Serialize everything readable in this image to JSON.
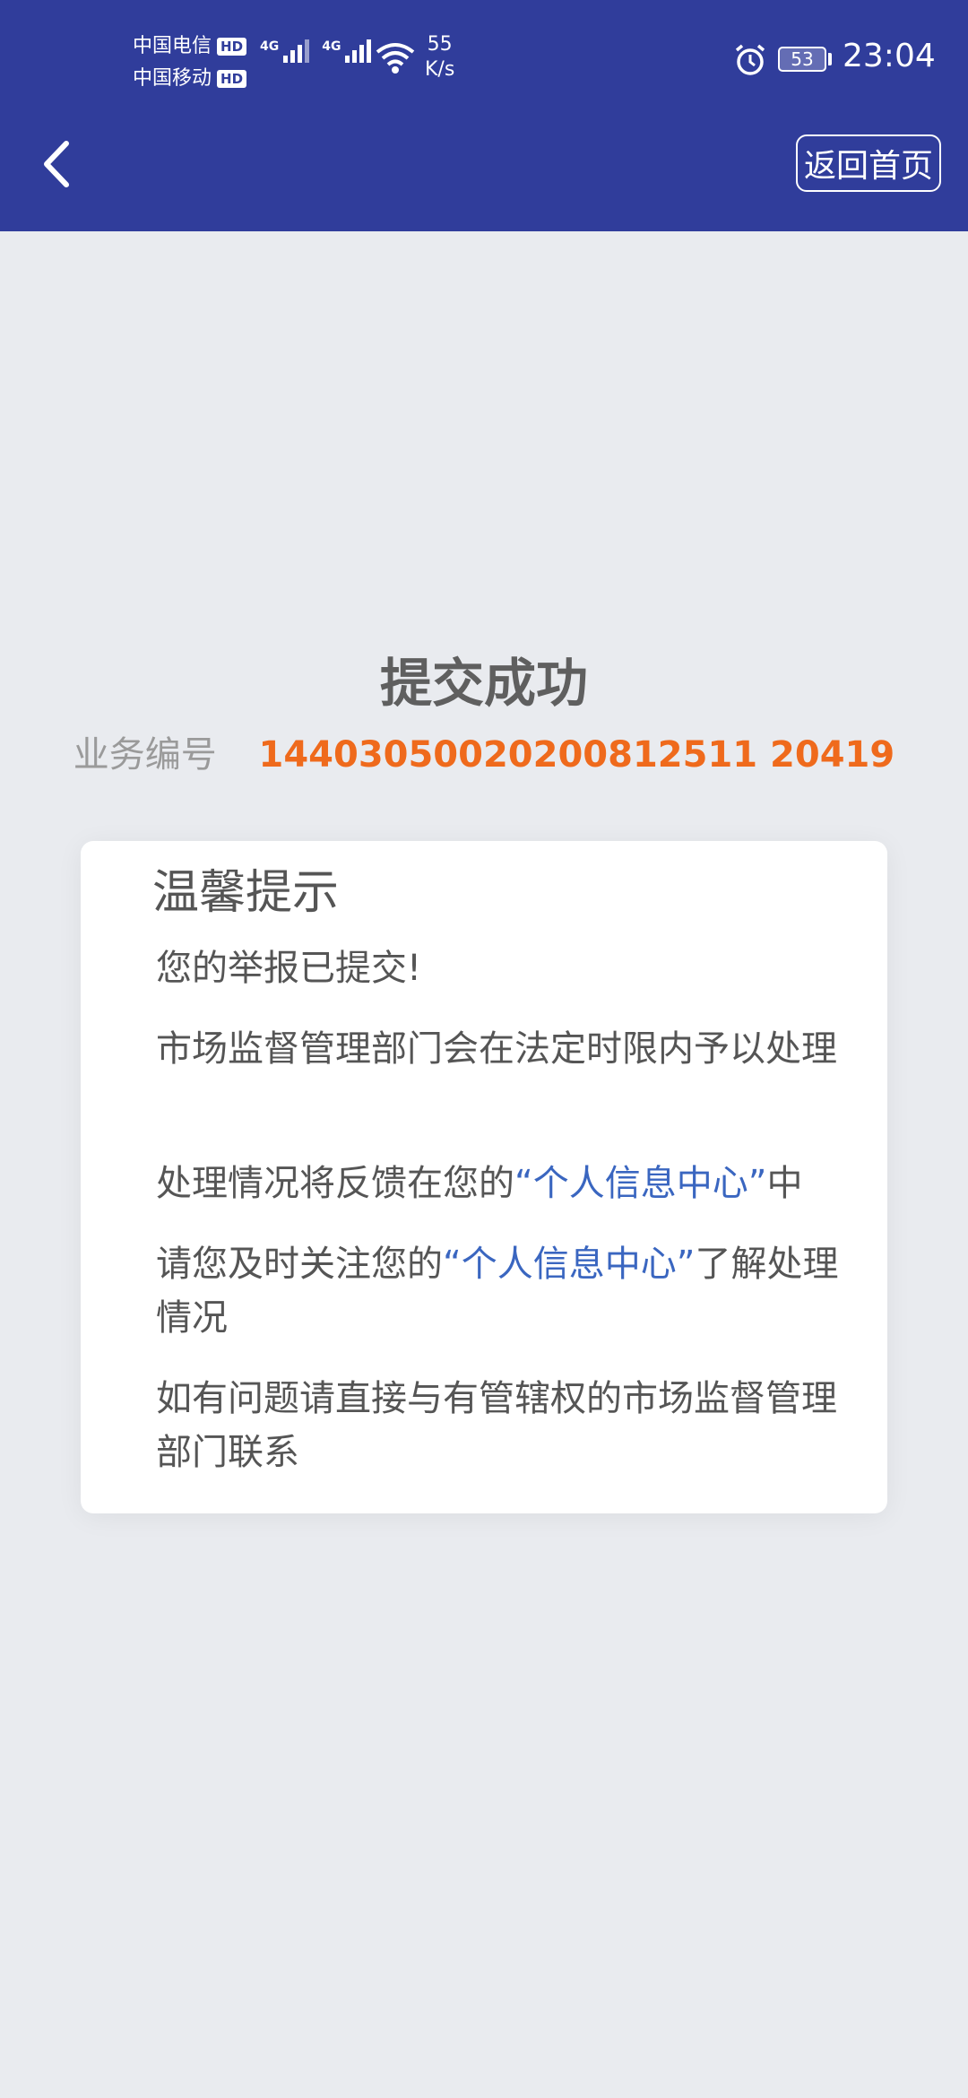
{
  "status_bar": {
    "carrier1": "中国电信",
    "carrier2": "中国移动",
    "hd_badge": "HD",
    "network_label": "4G",
    "speed_value": "55",
    "speed_unit": "K/s",
    "battery_level": "53",
    "time": "23:04"
  },
  "header": {
    "home_button_label": "返回首页"
  },
  "result": {
    "title": "提交成功",
    "biz_label": "业务编号",
    "biz_number": "14403050020200812511 20419"
  },
  "notice": {
    "title": "温馨提示",
    "line1": "您的举报已提交!",
    "line2": "市场监督管理部门会在法定时限内予以处理",
    "line3_prefix": "处理情况将反馈在您的",
    "line3_link": "“个人信息中心”",
    "line3_suffix": "中",
    "line4_prefix": "请您及时关注您的",
    "line4_link": "“个人信息中心”",
    "line4_suffix": "了解处理情况",
    "line5": "如有问题请直接与有管辖权的市场监督管理部门联系"
  },
  "colors": {
    "header_bg": "#303d9b",
    "page_bg": "#e9ebef",
    "accent_orange": "#ef6a1c",
    "link_blue": "#3a66c0"
  }
}
